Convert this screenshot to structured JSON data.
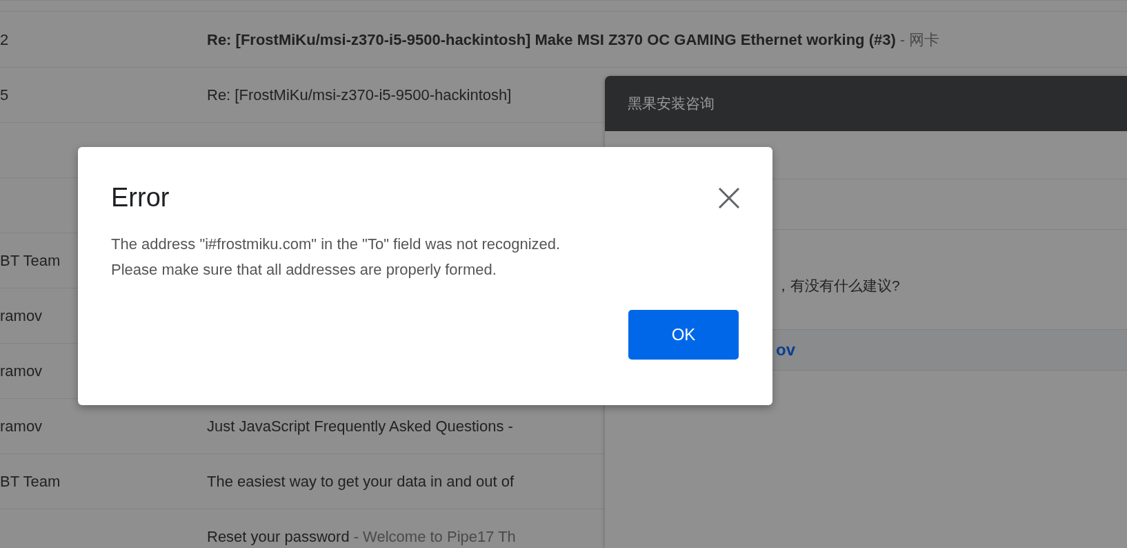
{
  "email_list": {
    "rows": [
      {
        "sender": "2",
        "subject": "Re: [FrostMiKu/msi-z370-i5-9500-hackintosh] Make MSI Z370 OC GAMING Ethernet working (#3)",
        "snippet": "- 网卡",
        "unread": true
      },
      {
        "sender": "5",
        "subject": "Re: [FrostMiKu/msi-z370-i5-9500-hackintosh]",
        "unread": false
      },
      {},
      {},
      {
        "sender": "BT Team"
      },
      {
        "sender": "ramov"
      },
      {
        "sender": "ramov"
      },
      {
        "sender": "ramov",
        "subject": "Just JavaScript Frequently Asked Questions -",
        "unread": false
      },
      {
        "sender": "BT Team",
        "subject": "The easiest way to get your data in and out of",
        "unread": false
      },
      {
        "subject": "Reset your password",
        "snippet": "- Welcome to Pipe17 Th",
        "unread": false
      }
    ]
  },
  "compose": {
    "title": "黑果安装咨询",
    "body_text": "，有没有什么建议?",
    "link": "ov"
  },
  "dialog": {
    "title": "Error",
    "message_lines": [
      "The address \"i#frostmiku.com\" in the \"To\" field was not recognized.",
      "Please make sure that all addresses are properly formed."
    ],
    "button": "OK"
  }
}
